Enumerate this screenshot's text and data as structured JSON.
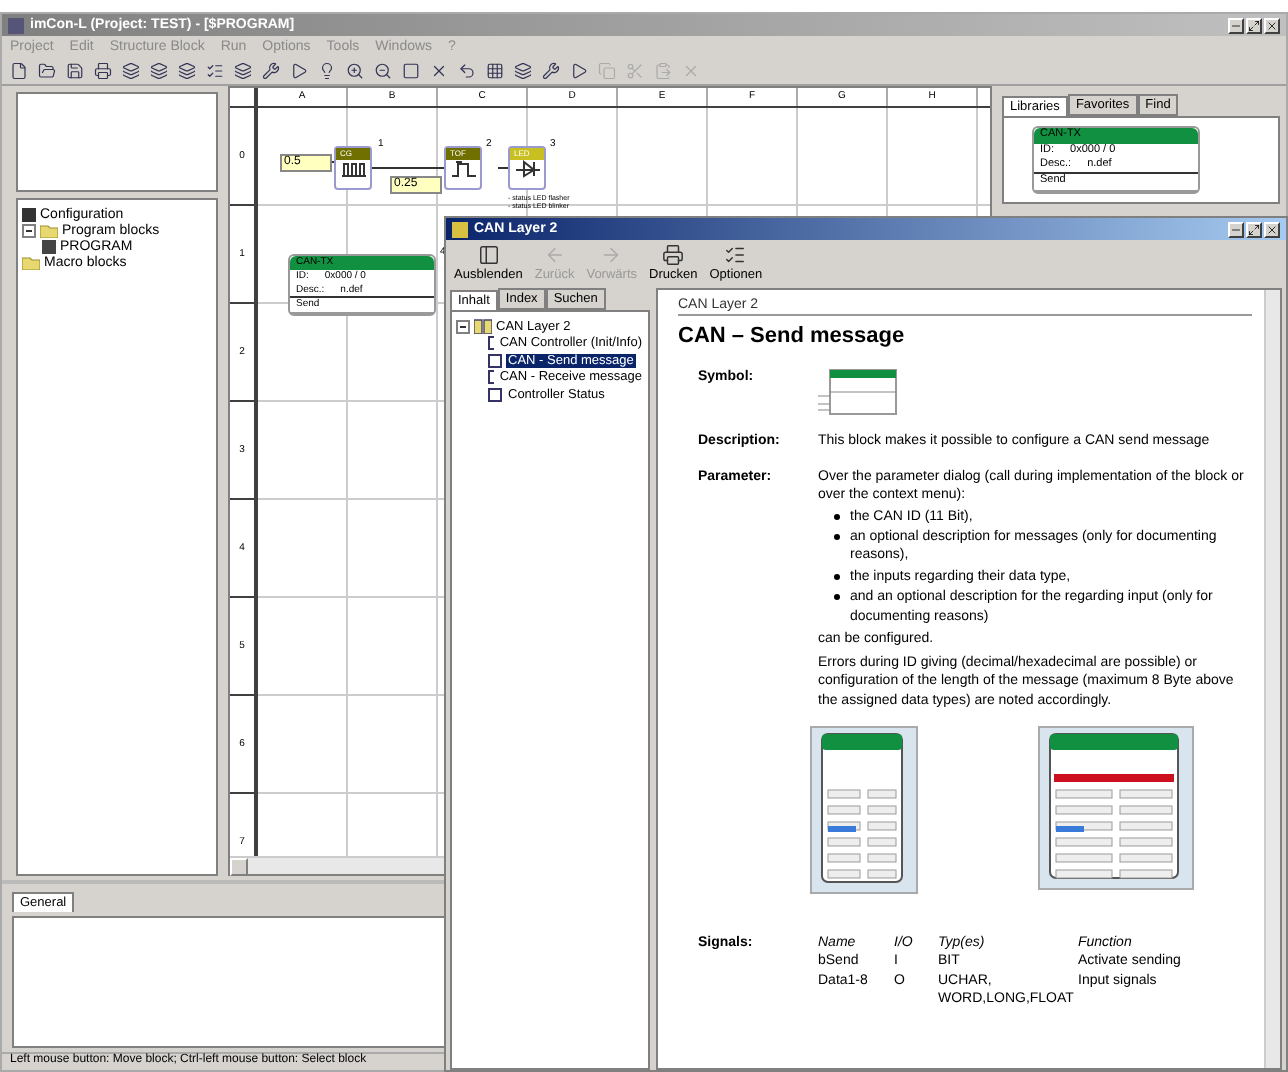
{
  "window": {
    "title": "imCon-L  (Project: TEST)  - [$PROGRAM]"
  },
  "menu": [
    "Project",
    "Edit",
    "Structure Block",
    "Run",
    "Options",
    "Tools",
    "Windows",
    "?"
  ],
  "project_tree": [
    {
      "label": "Configuration",
      "kind": "config"
    },
    {
      "label": "Program blocks",
      "kind": "folder",
      "expanded": true,
      "children": [
        {
          "label": "PROGRAM",
          "kind": "program"
        }
      ]
    },
    {
      "label": "Macro blocks",
      "kind": "folder"
    }
  ],
  "diagram": {
    "columns": [
      "A",
      "B",
      "C",
      "D",
      "E",
      "F",
      "G",
      "H"
    ],
    "rows": [
      "0",
      "1",
      "2",
      "3",
      "4",
      "5",
      "6",
      "7"
    ],
    "inputs": [
      {
        "value": "0.5"
      },
      {
        "value": "0.25"
      }
    ],
    "blocks": [
      {
        "kind": "clock",
        "title": "CG",
        "number": "1"
      },
      {
        "kind": "timer",
        "title": "TOF",
        "number": "2"
      },
      {
        "kind": "led",
        "title": "LED",
        "number": "3",
        "notes": [
          "- status LED flasher",
          "- status LED blinker"
        ]
      }
    ],
    "can_block": {
      "title": "CAN-TX",
      "number": "4",
      "id_label": "ID:",
      "id_value": "0x000 / 0",
      "desc_label": "Desc.:",
      "desc_value": "n.def",
      "port": "Send"
    }
  },
  "library": {
    "tabs": [
      {
        "label": "Libraries",
        "selected": true
      },
      {
        "label": "Favorites",
        "selected": false
      },
      {
        "label": "Find",
        "selected": false
      }
    ],
    "preview": {
      "title": "CAN-TX",
      "id_label": "ID:",
      "id_value": "0x000 / 0",
      "desc_label": "Desc.:",
      "desc_value": "n.def",
      "port": "Send"
    }
  },
  "properties": {
    "tabs": [
      {
        "label": "General",
        "selected": true
      }
    ]
  },
  "status_bar": "Left mouse button: Move block; Ctrl-left mouse button: Select block",
  "help": {
    "title": "CAN Layer 2",
    "toolbar": [
      {
        "label": "Ausblenden",
        "kind": "hide",
        "disabled": false
      },
      {
        "label": "Zurück",
        "kind": "back",
        "disabled": true
      },
      {
        "label": "Vorwärts",
        "kind": "forward",
        "disabled": true
      },
      {
        "label": "Drucken",
        "kind": "print",
        "disabled": false
      },
      {
        "label": "Optionen",
        "kind": "options",
        "disabled": false
      }
    ],
    "tabs": [
      {
        "label": "Inhalt",
        "selected": true
      },
      {
        "label": "Index",
        "selected": false
      },
      {
        "label": "Suchen",
        "selected": false
      }
    ],
    "tree": {
      "label": "CAN Layer 2",
      "expanded": true,
      "children": [
        {
          "label": "CAN Controller (Init/Info)",
          "selected": false
        },
        {
          "label": "CAN - Send message",
          "selected": true
        },
        {
          "label": "CAN - Receive message",
          "selected": false
        },
        {
          "label": "Controller Status",
          "selected": false
        }
      ]
    },
    "breadcrumb": "CAN Layer 2",
    "heading": "CAN – Send message",
    "symbol_label": "Symbol:",
    "description_label": "Description:",
    "description": "This block makes it possible to configure a CAN send message",
    "parameter_label": "Parameter:",
    "parameter_intro": "Over the parameter dialog (call during implementation of the block or over the context menu):",
    "parameter_items": [
      "the CAN ID (11 Bit),",
      "an optional description for messages (only for documenting reasons),",
      "the inputs regarding their data type,",
      "and an optional description for the regarding input (only for documenting reasons)"
    ],
    "parameter_after": [
      "can be configured.",
      "Errors during ID giving (decimal/hexadecimal are possible) or configuration of the length of the message (maximum 8 Byte above the assigned data types) are noted accordingly."
    ],
    "signals_label": "Signals:",
    "signals_columns": [
      "Name",
      "I/O",
      "Typ(es)",
      "Function"
    ],
    "signals_rows": [
      [
        "bSend",
        "I",
        "BIT",
        "Activate sending"
      ],
      [
        "Data1-8",
        "O",
        "UCHAR, WORD,LONG,FLOAT",
        "Input signals"
      ]
    ]
  }
}
